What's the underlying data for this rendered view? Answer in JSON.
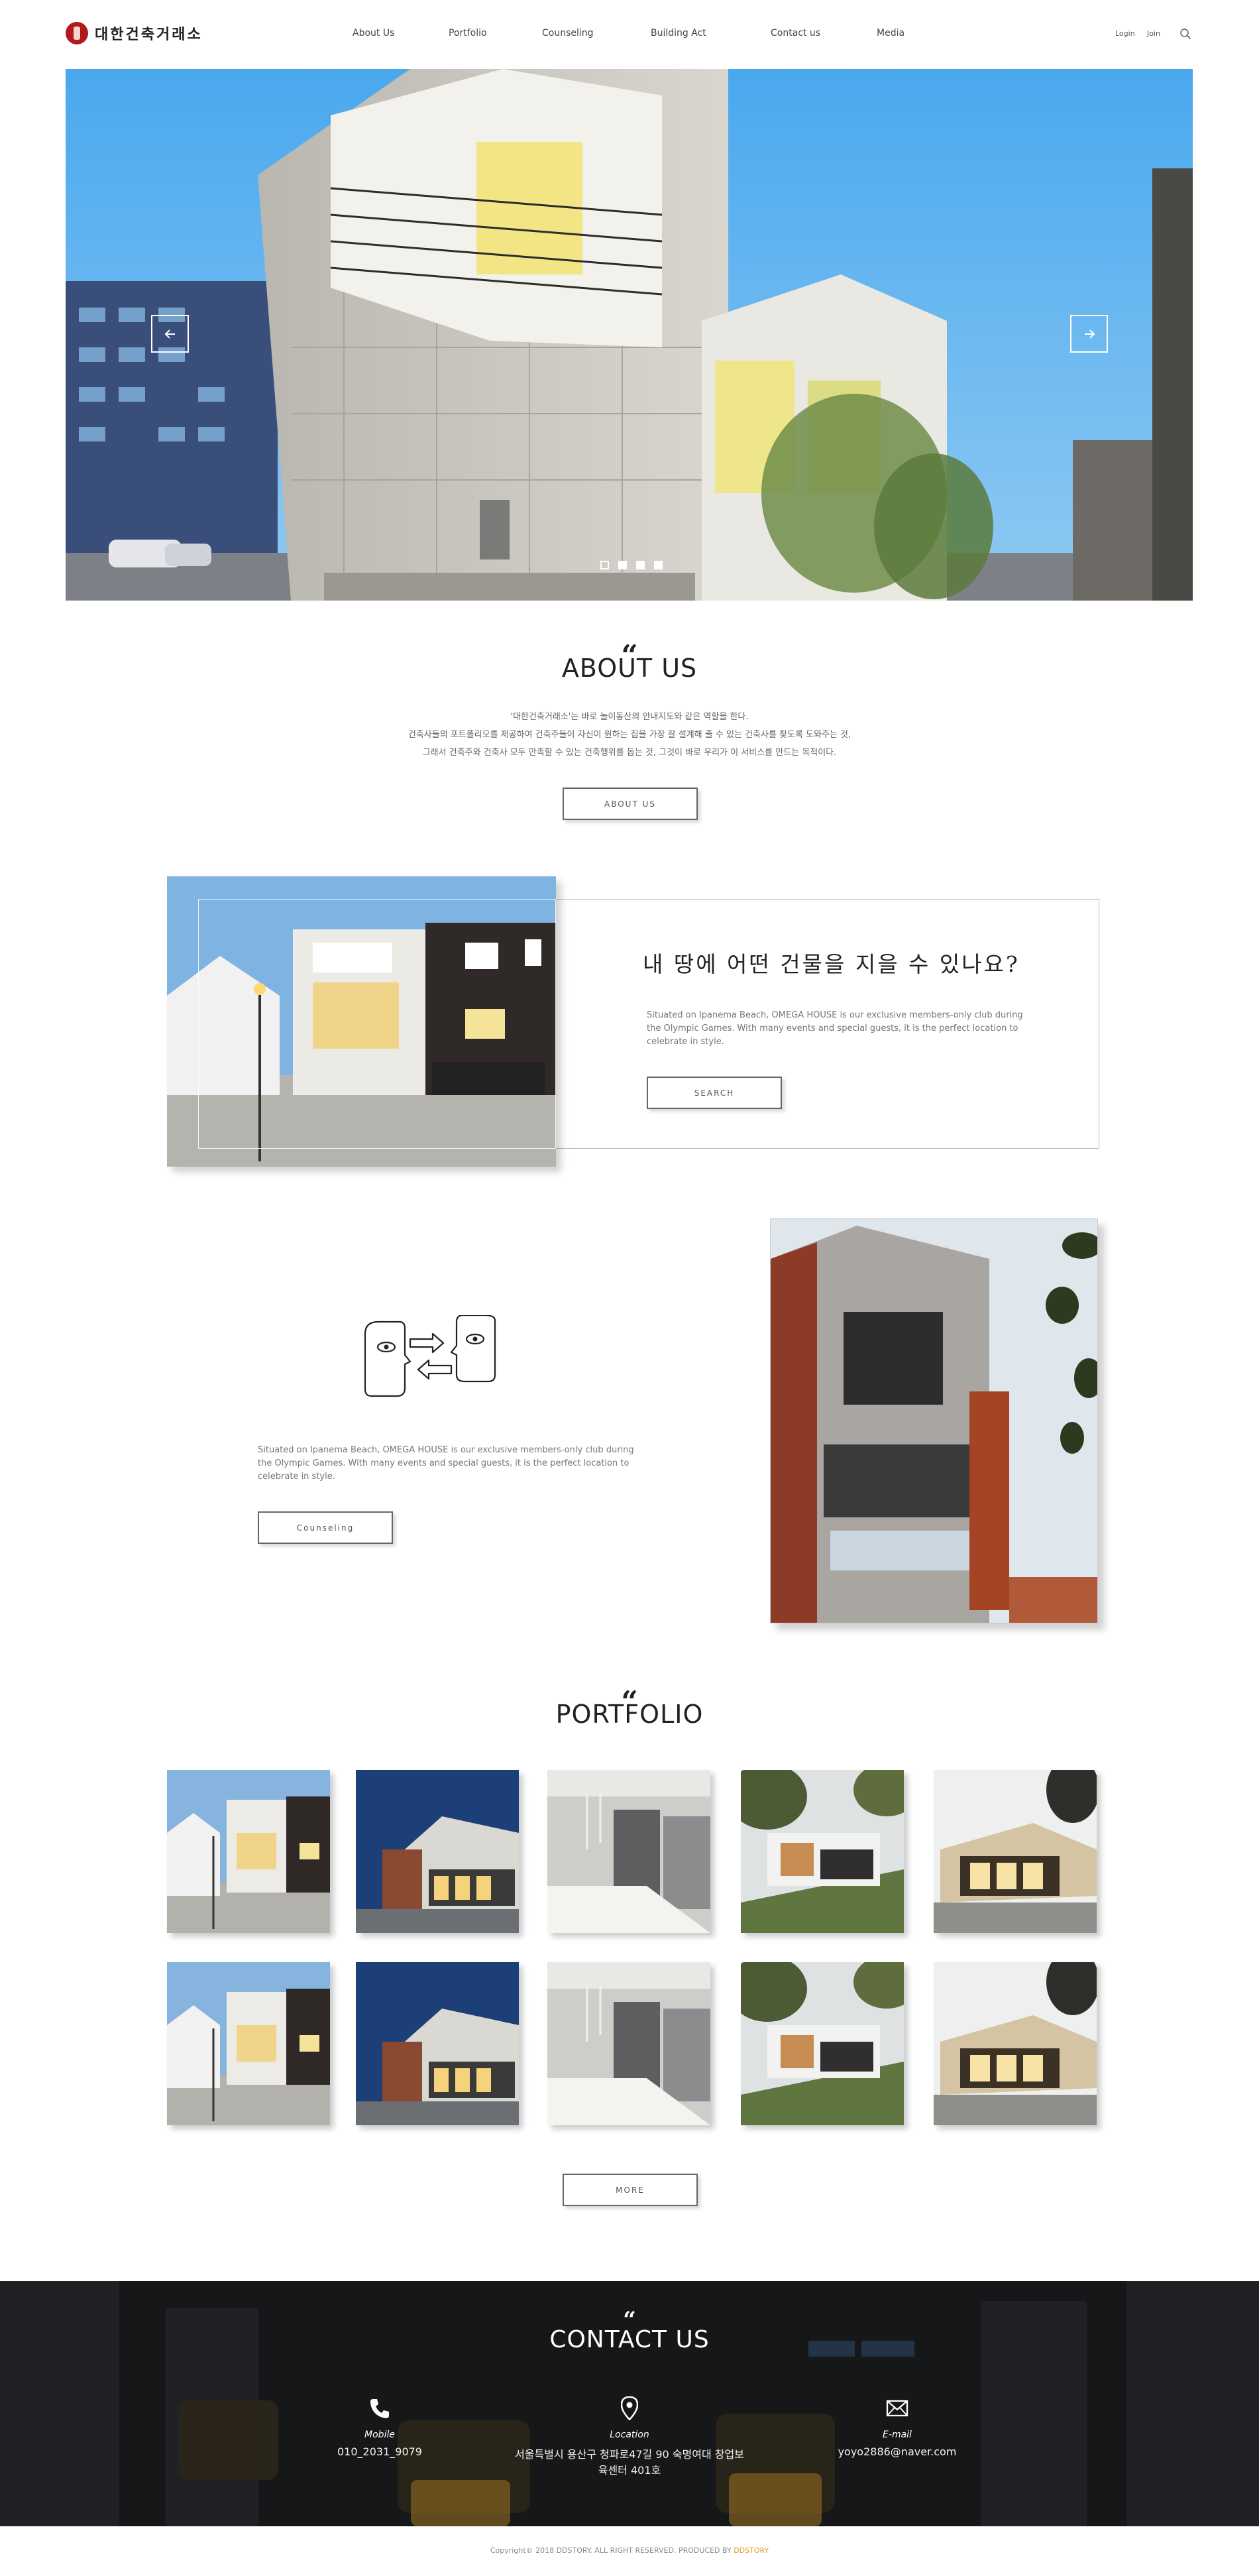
{
  "header": {
    "logo_text": "대한건축거래소",
    "nav": [
      {
        "label": "About Us"
      },
      {
        "label": "Portfolio"
      },
      {
        "label": "Counseling"
      },
      {
        "label": "Building Act"
      },
      {
        "label": "Contact us"
      },
      {
        "label": "Media"
      }
    ],
    "login_label": "Login",
    "join_label": "Join",
    "search_icon": "search-icon"
  },
  "hero": {
    "prev_icon": "arrow-left-icon",
    "next_icon": "arrow-right-icon",
    "slide_count": 4,
    "active_slide": 1
  },
  "about": {
    "quote": "“",
    "title": "ABOUT US",
    "lines": [
      "'대한건축거래소'는 바로 놀이동산의 안내지도와 같은 역할을 한다.",
      "건축사들의 포트폴리오를 제공하여 건축주들이 자신이 원하는 집을 가장 잘 설계해 줄 수 있는 건축사를 찾도록 도와주는 것,",
      "그래서 건축주와 건축사 모두 만족할 수 있는 건축행위를 돕는 것, 그것이 바로 우리가 이 서비스를 만드는 목적이다."
    ],
    "button_label": "ABOUT US"
  },
  "feature": {
    "title": "내 땅에 어떤 건물을 지을 수 있나요?",
    "description": "Situated on Ipanema Beach, OMEGA HOUSE is our exclusive members-only club during the Olympic Games. With many events and special guests, it is the perfect location to celebrate in style.",
    "button_label": "SEARCH"
  },
  "counseling": {
    "illustration_icon": "faces-exchange-icon",
    "description": "Situated on Ipanema Beach, OMEGA HOUSE is our exclusive members-only club during the Olympic Games. With many events and special guests, it is the perfect location to celebrate in style.",
    "button_label": "Counseling"
  },
  "portfolio": {
    "quote": "“",
    "title": "PORTFOLIO",
    "items": [
      {
        "variant": "a"
      },
      {
        "variant": "b"
      },
      {
        "variant": "c"
      },
      {
        "variant": "d"
      },
      {
        "variant": "e"
      },
      {
        "variant": "a"
      },
      {
        "variant": "b"
      },
      {
        "variant": "c"
      },
      {
        "variant": "d"
      },
      {
        "variant": "e"
      }
    ],
    "more_label": "MORE"
  },
  "contact": {
    "quote": "“",
    "title": "CONTACT US",
    "items": [
      {
        "icon": "phone-icon",
        "label": "Mobile",
        "value": "010_2031_9079"
      },
      {
        "icon": "location-pin-icon",
        "label": "Location",
        "value": "서울특별시 용산구 청파로47길 90 숙명여대 창업보육센터 401호"
      },
      {
        "icon": "mail-icon",
        "label": "E-mail",
        "value": "yoyo2886@naver.com"
      }
    ]
  },
  "footer": {
    "copyright": "Copyright© 2018 DDSTORY. ALL RIGHT RESERVED.  PRODUCED BY",
    "producer": "DDSTORY"
  },
  "colors": {
    "accent": "#e39b2d",
    "logo_red": "#b01a1a",
    "contact_bg": "#1b1d20"
  }
}
